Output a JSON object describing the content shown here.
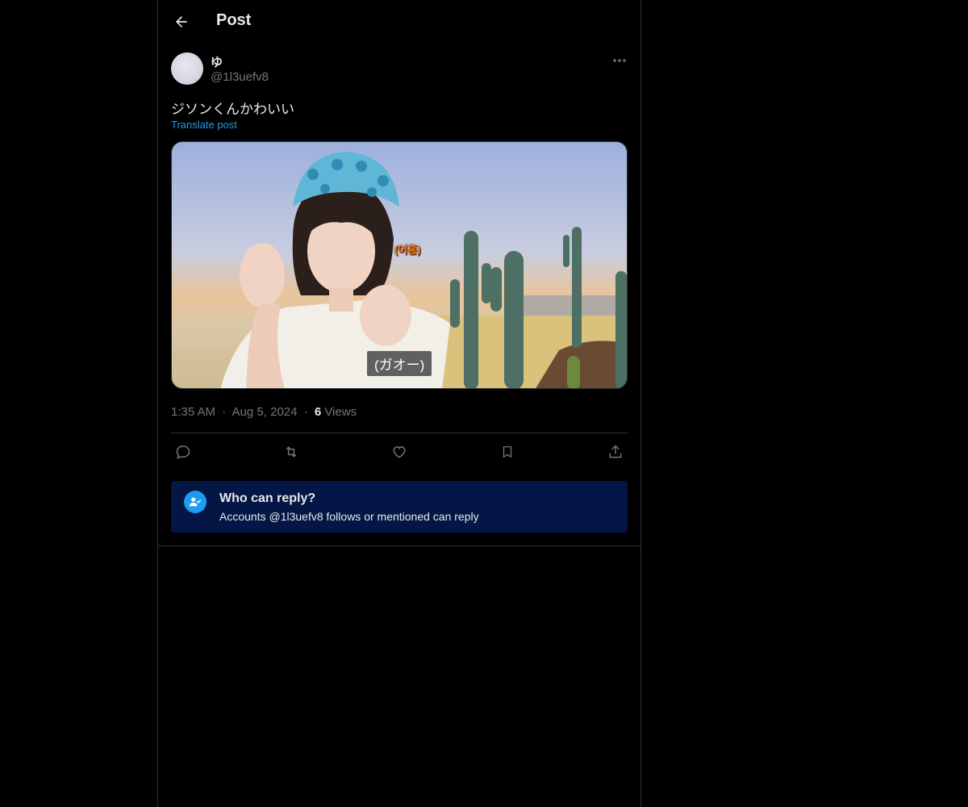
{
  "header": {
    "title": "Post"
  },
  "author": {
    "display_name": "ゆ",
    "handle": "@1l3uefv8"
  },
  "post": {
    "text": "ジソンくんかわいい",
    "translate_label": "Translate post",
    "media": {
      "caption": "(ガオー)",
      "sticker": "(어흥)"
    }
  },
  "meta": {
    "time": "1:35 AM",
    "date": "Aug 5, 2024",
    "views_count": "6",
    "views_label": "Views",
    "separator": "·"
  },
  "actions": {
    "icons": [
      "reply-icon",
      "repost-icon",
      "like-icon",
      "bookmark-icon",
      "share-icon"
    ]
  },
  "reply_restriction": {
    "title": "Who can reply?",
    "subtitle": "Accounts @1l3uefv8 follows or mentioned can reply",
    "icon": "person-check-icon"
  },
  "colors": {
    "background": "#000000",
    "border": "#2f3336",
    "accent": "#1d9bf0",
    "muted": "#71767b",
    "notice_bg": "#031645"
  }
}
